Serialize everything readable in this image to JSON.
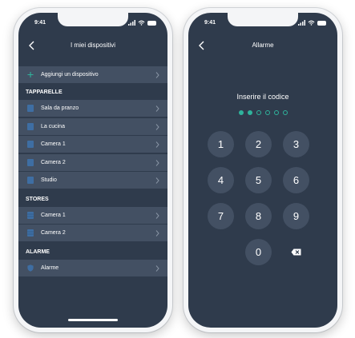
{
  "phone1": {
    "status": {
      "time": "9:41"
    },
    "nav": {
      "title": "I miei dispositivi"
    },
    "add_row": {
      "label": "Aggiungi un dispositivo"
    },
    "sections": [
      {
        "title": "TAPPARELLE",
        "items": [
          "Sala da pranzo",
          "La cucina",
          "Camera 1",
          "Camera 2",
          "Studio"
        ]
      },
      {
        "title": "STORES",
        "items": [
          "Camera 1",
          "Camera 2"
        ]
      },
      {
        "title": "ALARME",
        "items": [
          "Alarme"
        ]
      }
    ]
  },
  "phone2": {
    "status": {
      "time": "9:41"
    },
    "nav": {
      "title": "Allarme"
    },
    "prompt": "Inserire il codice",
    "pin": {
      "length": 6,
      "entered": 2
    },
    "keys": [
      "1",
      "2",
      "3",
      "4",
      "5",
      "6",
      "7",
      "8",
      "9",
      "0"
    ]
  },
  "colors": {
    "screen_bg": "#2f3b4c",
    "row_bg": "#435063",
    "accent": "#2fb39c",
    "icon_blue": "#3e6ea3"
  }
}
